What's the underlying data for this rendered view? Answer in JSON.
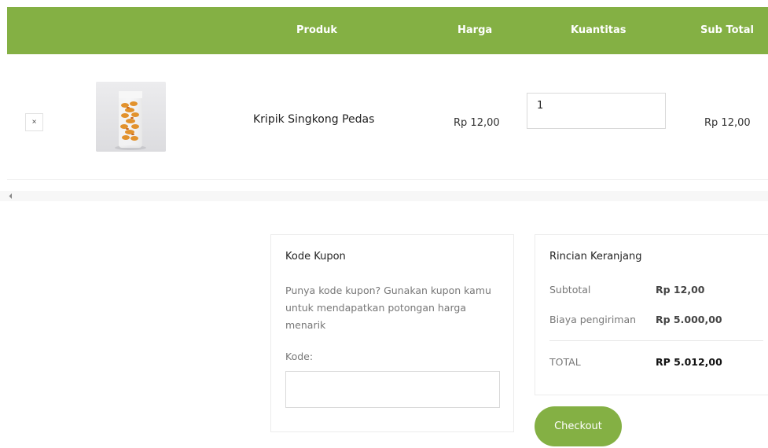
{
  "cart_table": {
    "headers": {
      "product": "Produk",
      "price": "Harga",
      "quantity": "Kuantitas",
      "subtotal": "Sub Total"
    },
    "items": [
      {
        "remove_icon": "close-icon",
        "remove_label": "×",
        "name": "Kripik Singkong Pedas",
        "price": "Rp 12,00",
        "quantity": "1",
        "subtotal": "Rp 12,00"
      }
    ]
  },
  "coupon": {
    "title": "Kode Kupon",
    "description": "Punya kode kupon? Gunakan kupon kamu untuk mendapatkan potongan harga menarik",
    "label": "Kode:",
    "value": ""
  },
  "summary": {
    "title": "Rincian Keranjang",
    "rows": [
      {
        "label": "Subtotal",
        "value": "Rp 12,00"
      },
      {
        "label": "Biaya pengiriman",
        "value": "Rp 5.000,00"
      },
      {
        "label": "TOTAL",
        "value": "RP 5.012,00"
      }
    ]
  },
  "checkout": {
    "label": "Checkout"
  },
  "colors": {
    "accent": "#84b044",
    "border": "#ececec",
    "muted_text": "#777777"
  }
}
